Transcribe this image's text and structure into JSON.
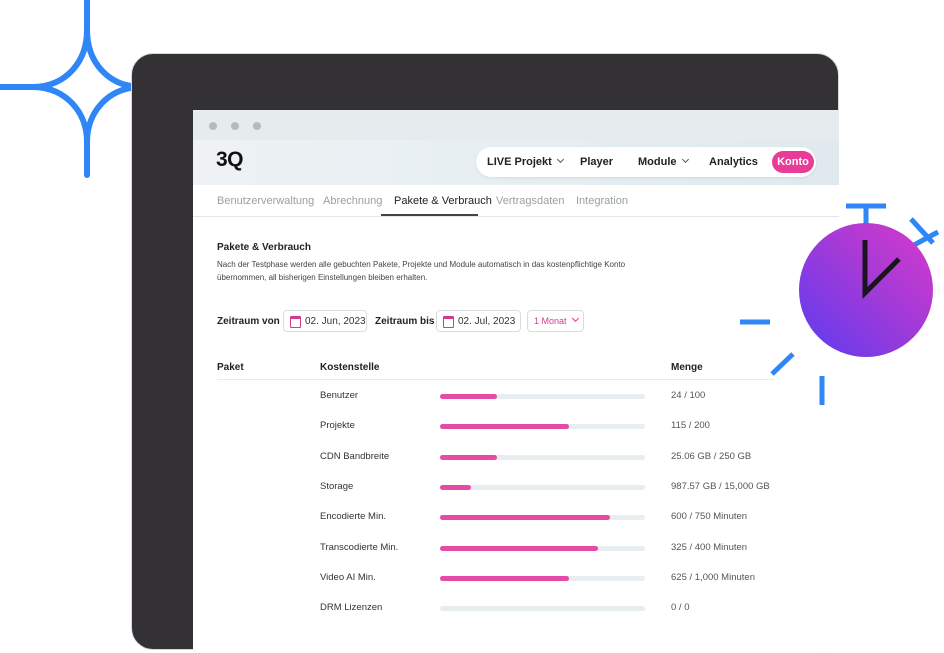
{
  "colors": {
    "accent": "#e83c98",
    "bar_fill": "#e44aa6",
    "bar_track": "#e8edf0",
    "decor_blue": "#2f86f6",
    "frame": "#333133"
  },
  "window": {
    "logo": "3Q"
  },
  "nav": {
    "items": [
      {
        "label": "LIVE Projekt",
        "has_dropdown": true
      },
      {
        "label": "Player",
        "has_dropdown": false
      },
      {
        "label": "Module",
        "has_dropdown": true
      },
      {
        "label": "Analytics",
        "has_dropdown": false
      }
    ],
    "konto_label": "Konto"
  },
  "tabs": [
    "Benutzerverwaltung",
    "Abrechnung",
    "Pakete & Verbrauch",
    "Vertragsdaten",
    "Integration"
  ],
  "active_tab": "Pakete & Verbrauch",
  "section": {
    "title": "Pakete & Verbrauch",
    "description": "Nach der Testphase werden alle gebuchten Pakete, Projekte und Module automatisch in das kostenpflichtige Konto übernommen, all bisherigen Einstellungen bleiben erhalten."
  },
  "filters": {
    "from_label": "Zeitraum  von",
    "from_value": "02. Jun, 2023",
    "to_label": "Zeitraum bis",
    "to_value": "02. Jul, 2023",
    "period": "1 Monat"
  },
  "table": {
    "headers": {
      "paket": "Paket",
      "kostenstelle": "Kostenstelle",
      "menge": "Menge"
    },
    "rows": [
      {
        "name": "Benutzer",
        "amount": "24 / 100",
        "fraction": 0.28
      },
      {
        "name": "Projekte",
        "amount": "115 / 200",
        "fraction": 0.63
      },
      {
        "name": "CDN Bandbreite",
        "amount": "25.06 GB / 250 GB",
        "fraction": 0.28
      },
      {
        "name": "Storage",
        "amount": "987.57 GB / 15,000 GB",
        "fraction": 0.15
      },
      {
        "name": "Encodierte Min.",
        "amount": "600 / 750 Minuten",
        "fraction": 0.83
      },
      {
        "name": "Transcodierte Min.",
        "amount": "325 / 400 Minuten",
        "fraction": 0.77
      },
      {
        "name": "Video AI Min.",
        "amount": "625 / 1,000 Minuten",
        "fraction": 0.63
      },
      {
        "name": "DRM Lizenzen",
        "amount": "0 / 0",
        "fraction": 0
      }
    ]
  }
}
